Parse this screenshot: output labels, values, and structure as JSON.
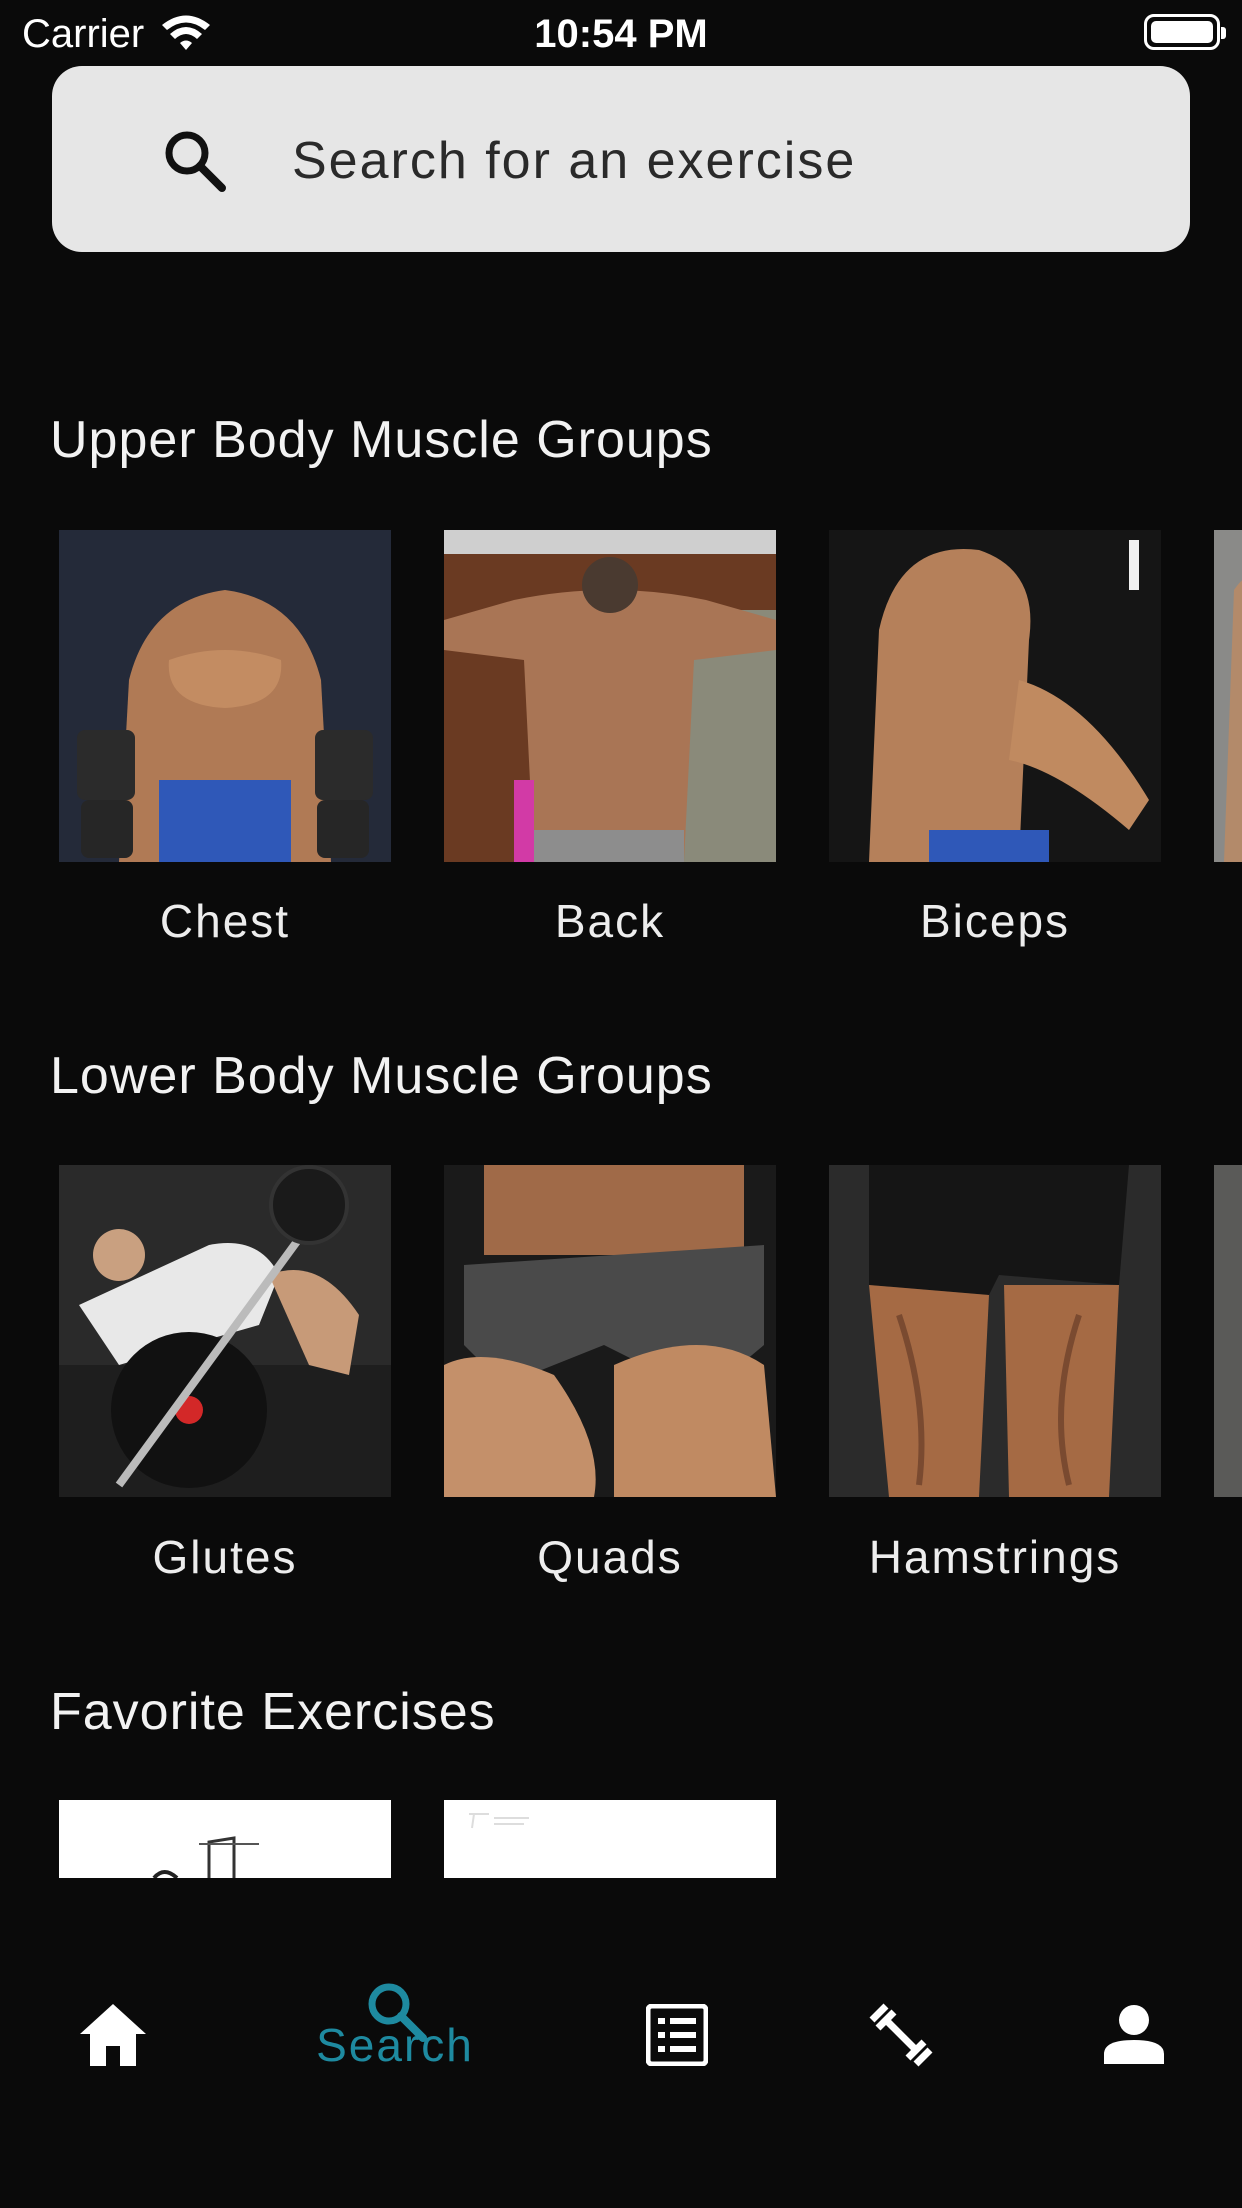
{
  "status_bar": {
    "carrier": "Carrier",
    "time": "10:54 PM"
  },
  "search": {
    "placeholder": "Search for an exercise",
    "value": ""
  },
  "upper_body": {
    "title": "Upper Body Muscle Groups",
    "items": [
      {
        "label": "Chest"
      },
      {
        "label": "Back"
      },
      {
        "label": "Biceps"
      }
    ]
  },
  "lower_body": {
    "title": "Lower Body Muscle Groups",
    "items": [
      {
        "label": "Glutes"
      },
      {
        "label": "Quads"
      },
      {
        "label": "Hamstrings"
      }
    ]
  },
  "favorites": {
    "title": "Favorite Exercises"
  },
  "nav": {
    "active": "Search",
    "items": [
      {
        "icon": "home-icon"
      },
      {
        "icon": "search-icon",
        "label": "Search"
      },
      {
        "icon": "list-icon"
      },
      {
        "icon": "dumbbell-icon"
      },
      {
        "icon": "person-icon"
      }
    ],
    "active_color": "#1e8aa0",
    "inactive_color": "#ffffff"
  }
}
